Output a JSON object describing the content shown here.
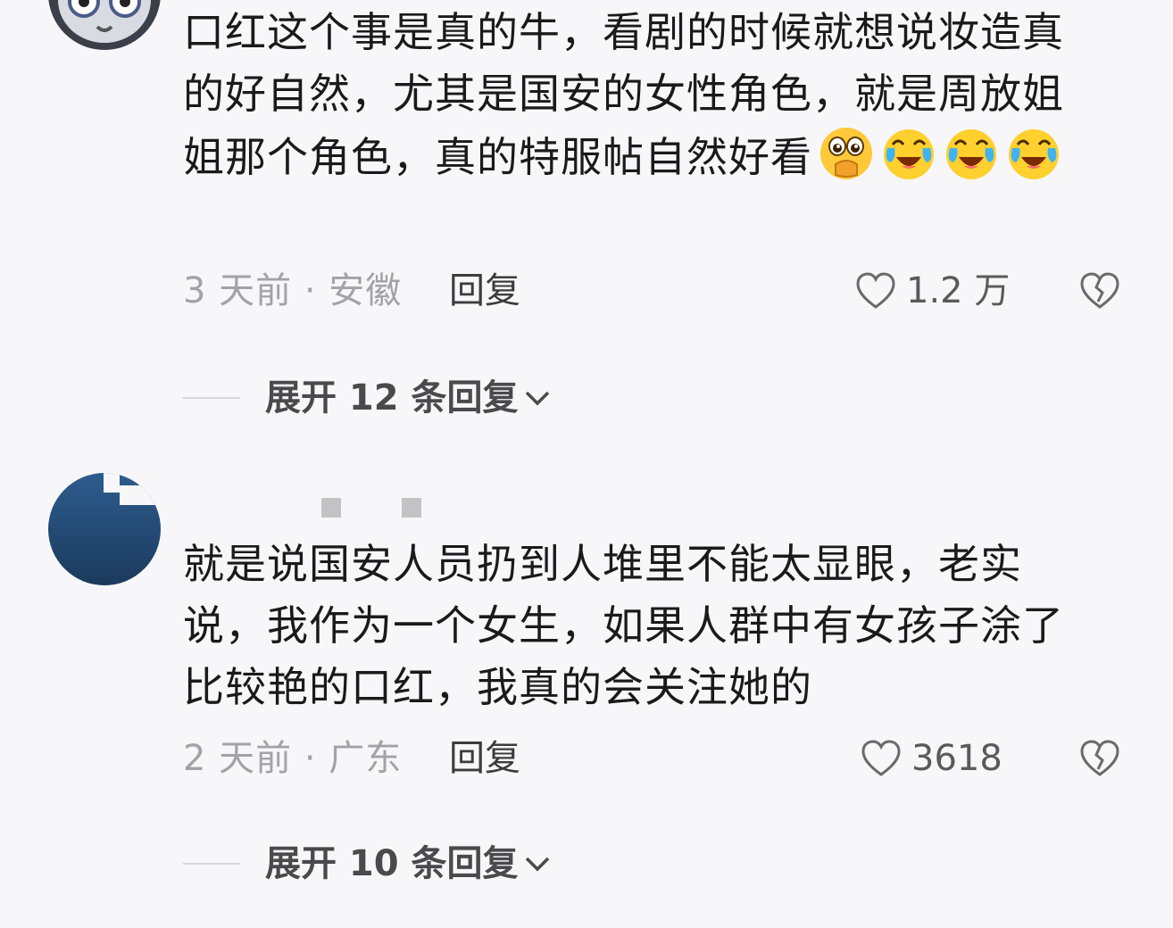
{
  "comments": [
    {
      "text": "口红这个事是真的牛，看剧的时候就想说妆造真的好自然，尤其是国安的女性角色，就是周放姐姐那个角色，真的特服帖自然好看",
      "emojis": [
        "cover-mouth-emoji",
        "tears-of-joy-emoji",
        "tears-of-joy-emoji",
        "tears-of-joy-emoji"
      ],
      "time_location": "3 天前 · 安徽",
      "reply_label": "回复",
      "like_count": "1.2 万",
      "expand_label": "展开 12 条回复"
    },
    {
      "text": "就是说国安人员扔到人堆里不能太显眼，老实说，我作为一个女生，如果人群中有女孩子涂了比较艳的口红，我真的会关注她的",
      "time_location": "2 天前 · 广东",
      "reply_label": "回复",
      "like_count": "3618",
      "expand_label": "展开 10 条回复"
    }
  ],
  "colors": {
    "background": "#f7f7fa",
    "text_primary": "#1a1a1a",
    "text_meta": "#a2a2a8",
    "avatar_blue": "#2b5a8a"
  },
  "icons": {
    "like": "heart-outline-icon",
    "dislike": "broken-heart-icon",
    "expand": "chevron-down-icon"
  }
}
